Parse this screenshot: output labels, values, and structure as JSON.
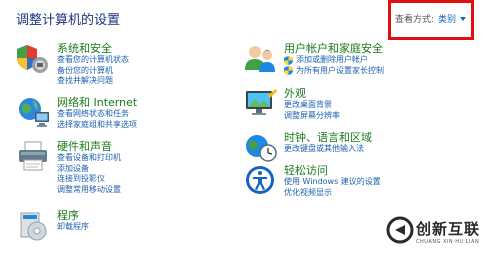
{
  "header": {
    "title": "调整计算机的设置",
    "view_by_label": "查看方式:",
    "view_by_value": "类别"
  },
  "categories": [
    {
      "title": "系统和安全",
      "links": [
        "查看您的计算机状态",
        "备份您的计算机",
        "查找并解决问题"
      ]
    },
    {
      "title": "网络和 Internet",
      "links": [
        "查看网络状态和任务",
        "选择家庭组和共享选项"
      ]
    },
    {
      "title": "硬件和声音",
      "links": [
        "查看设备和打印机",
        "添加设备",
        "连接到投影仪",
        "调整常用移动设置"
      ]
    },
    {
      "title": "程序",
      "links": [
        "卸载程序"
      ]
    },
    {
      "title": "用户帐户和家庭安全",
      "links": [
        "添加或删除用户帐户",
        "为所有用户设置家长控制"
      ]
    },
    {
      "title": "外观",
      "links": [
        "更改桌面背景",
        "调整屏幕分辨率"
      ]
    },
    {
      "title": "时钟、语言和区域",
      "links": [
        "更改键盘或其他输入法"
      ]
    },
    {
      "title": "轻松访问",
      "links": [
        "使用 Windows 建议的设置",
        "优化视频显示"
      ]
    }
  ],
  "watermark": {
    "text": "创新互联",
    "subtext": "CHUANG XIN HU LIAN"
  }
}
